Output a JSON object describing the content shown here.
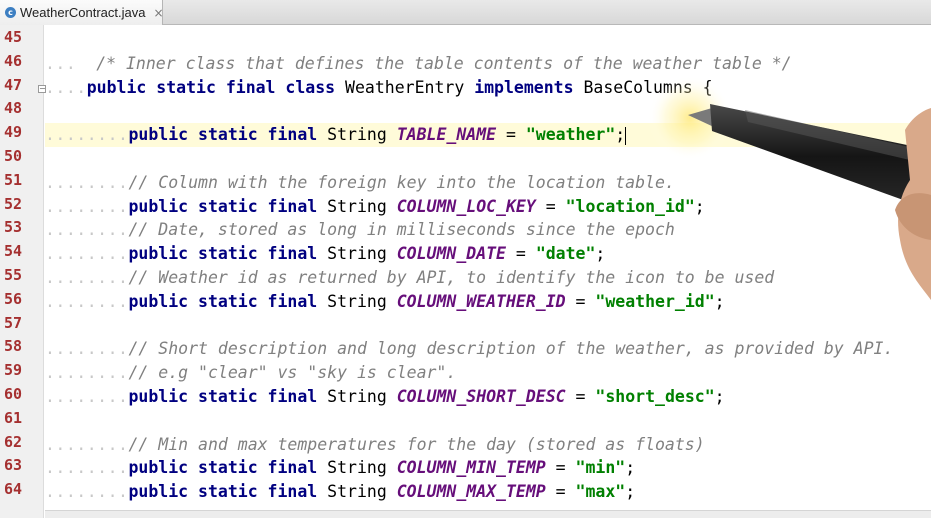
{
  "tab": {
    "icon_letter": "c",
    "title": "WeatherContract.java",
    "close": "×"
  },
  "line_numbers": [
    "45",
    "46",
    "47",
    "48",
    "49",
    "50",
    "51",
    "52",
    "53",
    "54",
    "55",
    "56",
    "57",
    "58",
    "59",
    "60",
    "61",
    "62",
    "63",
    "64"
  ],
  "code": {
    "l46_comment": "/* Inner class that defines the table contents of the weather table */",
    "l47_kw": "public static final class",
    "l47_name": " WeatherEntry ",
    "l47_kw2": "implements",
    "l47_rest": " BaseColumns {",
    "modifiers": "public static final",
    "type": " String ",
    "eq": " = ",
    "semi": ";",
    "l49_const": "TABLE_NAME",
    "l49_val": "\"weather\"",
    "l51_comment": "// Column with the foreign key into the location table.",
    "l52_const": "COLUMN_LOC_KEY",
    "l52_val": "\"location_id\"",
    "l53_comment": "// Date, stored as long in milliseconds since the epoch",
    "l54_const": "COLUMN_DATE",
    "l54_val": "\"date\"",
    "l55_comment": "// Weather id as returned by API, to identify the icon to be used",
    "l56_const": "COLUMN_WEATHER_ID",
    "l56_val": "\"weather_id\"",
    "l58_comment": "// Short description and long description of the weather, as provided by API.",
    "l59_comment": "// e.g \"clear\" vs \"sky is clear\".",
    "l60_const": "COLUMN_SHORT_DESC",
    "l60_val": "\"short_desc\"",
    "l62_comment": "// Min and max temperatures for the day (stored as floats)",
    "l63_const": "COLUMN_MIN_TEMP",
    "l63_val": "\"min\"",
    "l64_const": "COLUMN_MAX_TEMP",
    "l64_val": "\"max\""
  },
  "colors": {
    "keyword": "#000080",
    "comment": "#808080",
    "constant": "#660e7a",
    "string": "#008000",
    "line_number": "#a53030",
    "current_line": "#fffbd9"
  }
}
